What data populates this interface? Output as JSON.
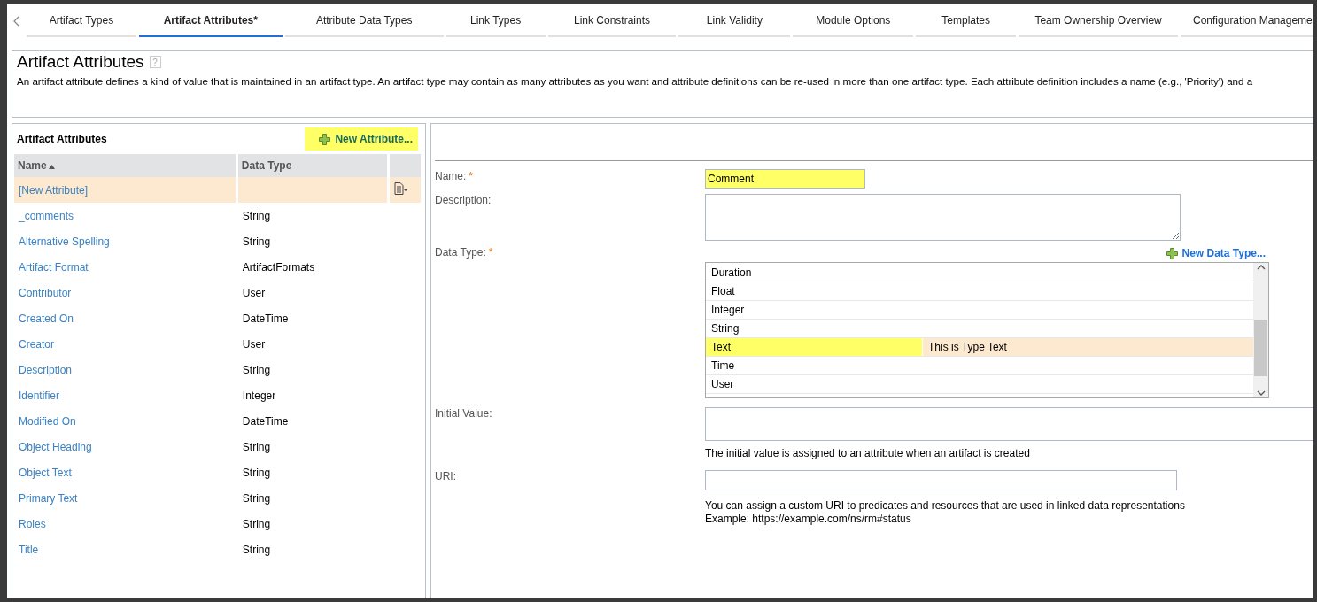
{
  "tabs": [
    {
      "label": "Artifact Types",
      "selected": false
    },
    {
      "label": "Artifact Attributes*",
      "selected": true
    },
    {
      "label": "Attribute Data Types",
      "selected": false
    },
    {
      "label": "Link Types",
      "selected": false
    },
    {
      "label": "Link Constraints",
      "selected": false
    },
    {
      "label": "Link Validity",
      "selected": false
    },
    {
      "label": "Module Options",
      "selected": false
    },
    {
      "label": "Templates",
      "selected": false
    },
    {
      "label": "Team Ownership Overview",
      "selected": false
    },
    {
      "label": "Configuration Manageme",
      "selected": false
    }
  ],
  "header": {
    "title": "Artifact Attributes",
    "help": "?",
    "description": "An artifact attribute defines a kind of value that is maintained in an artifact type. An artifact type may contain as many attributes as you want and attribute definitions can be re-used in more than one artifact type. Each attribute definition includes a name (e.g., 'Priority') and a"
  },
  "attributes_panel": {
    "title": "Artifact Attributes",
    "new_button": {
      "label": "New Attribute...",
      "highlighted": true
    },
    "columns": [
      {
        "label": "Name",
        "sorted": true
      },
      {
        "label": "Data Type",
        "sorted": false
      }
    ],
    "rows": [
      {
        "name": "[New Attribute]",
        "selected": true
      },
      {
        "name": "_comments",
        "data_type": "String",
        "selected": false
      },
      {
        "name": "Alternative Spelling",
        "data_type": "String",
        "selected": false
      },
      {
        "name": "Artifact Format",
        "data_type": "ArtifactFormats",
        "selected": false
      },
      {
        "name": "Contributor",
        "data_type": "User",
        "selected": false
      },
      {
        "name": "Created On",
        "data_type": "DateTime",
        "selected": false
      },
      {
        "name": "Creator",
        "data_type": "User",
        "selected": false
      },
      {
        "name": "Description",
        "data_type": "String",
        "selected": false
      },
      {
        "name": "Identifier",
        "data_type": "Integer",
        "selected": false
      },
      {
        "name": "Modified On",
        "data_type": "DateTime",
        "selected": false
      },
      {
        "name": "Object Heading",
        "data_type": "String",
        "selected": false
      },
      {
        "name": "Object Text",
        "data_type": "String",
        "selected": false
      },
      {
        "name": "Primary Text",
        "data_type": "String",
        "selected": false
      },
      {
        "name": "Roles",
        "data_type": "String",
        "selected": false
      },
      {
        "name": "Title",
        "data_type": "String",
        "selected": false
      }
    ]
  },
  "form": {
    "name": {
      "label": "Name:",
      "required": "*",
      "value": "Comment",
      "highlighted": true
    },
    "description": {
      "label": "Description:"
    },
    "data_type": {
      "label": "Data Type:",
      "required": "*",
      "new_link": "New Data Type...",
      "options": [
        {
          "name": "Duration",
          "selected": false,
          "highlighted": false
        },
        {
          "name": "Float",
          "selected": false,
          "highlighted": false
        },
        {
          "name": "Integer",
          "selected": false,
          "highlighted": false
        },
        {
          "name": "String",
          "selected": false,
          "highlighted": false
        },
        {
          "name": "Text",
          "description": "This is Type Text",
          "selected": true,
          "highlighted": true
        },
        {
          "name": "Time",
          "selected": false,
          "highlighted": false
        },
        {
          "name": "User",
          "selected": false,
          "highlighted": false
        }
      ]
    },
    "initial_value": {
      "label": "Initial Value:",
      "hint": "The initial value is assigned to an attribute when an artifact is created"
    },
    "uri": {
      "label": "URI:",
      "hint": "You can assign a custom URI to predicates and resources that are used in linked data representations",
      "example": "Example: https://example.com/ns/rm#status"
    }
  }
}
